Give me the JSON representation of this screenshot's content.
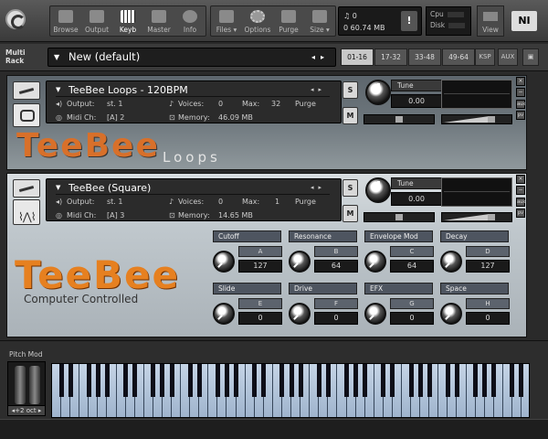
{
  "toolbar": {
    "buttons": [
      {
        "label": "Browse",
        "icon": "folder-icon"
      },
      {
        "label": "Output",
        "icon": "output-icon"
      },
      {
        "label": "Keyb",
        "icon": "keyboard-icon",
        "active": true
      },
      {
        "label": "Master",
        "icon": "metronome-icon"
      },
      {
        "label": "Info",
        "icon": "info-icon"
      }
    ],
    "buttons2": [
      {
        "label": "Files ▾",
        "icon": "disk-icon"
      },
      {
        "label": "Options",
        "icon": "gear-icon"
      },
      {
        "label": "Purge",
        "icon": "purge-icon"
      },
      {
        "label": "Size ▾",
        "icon": "size-icon"
      }
    ],
    "midi_count": "0",
    "memory": "60.74 MB",
    "cpu_label": "Cpu",
    "disk_label": "Disk",
    "view_label": "View",
    "ni_logo": "NI",
    "warn": "!"
  },
  "rack": {
    "label_line1": "Multi",
    "label_line2": "Rack",
    "name": "New (default)",
    "pages": [
      "01-16",
      "17-32",
      "33-48",
      "49-64"
    ],
    "ksp": "KSP",
    "aux": "AUX"
  },
  "instrument1": {
    "name": "TeeBee Loops - 120BPM",
    "output_label": "Output:",
    "output_value": "st. 1",
    "voices_label": "Voices:",
    "voices_value": "0",
    "max_label": "Max:",
    "max_value": "32",
    "purge_label": "Purge",
    "midi_label": "Midi Ch:",
    "midi_value": "[A]  2",
    "memory_label": "Memory:",
    "memory_value": "46.09 MB",
    "tune_label": "Tune",
    "tune_value": "0.00",
    "solo": "S",
    "mute": "M",
    "logo": "TeeBee",
    "subtitle": "Loops"
  },
  "instrument2": {
    "name": "TeeBee (Square)",
    "output_label": "Output:",
    "output_value": "st. 1",
    "voices_label": "Voices:",
    "voices_value": "0",
    "max_label": "Max:",
    "max_value": "1",
    "purge_label": "Purge",
    "midi_label": "Midi Ch:",
    "midi_value": "[A]  3",
    "memory_label": "Memory:",
    "memory_value": "14.65 MB",
    "tune_label": "Tune",
    "tune_value": "0.00",
    "solo": "S",
    "mute": "M",
    "logo": "TeeBee",
    "subtitle": "Computer Controlled",
    "controls": [
      {
        "label": "Cutoff",
        "key": "A",
        "value": "127"
      },
      {
        "label": "Resonance",
        "key": "B",
        "value": "64"
      },
      {
        "label": "Envelope Mod",
        "key": "C",
        "value": "64"
      },
      {
        "label": "Decay",
        "key": "D",
        "value": "127"
      },
      {
        "label": "Slide",
        "key": "E",
        "value": "0"
      },
      {
        "label": "Drive",
        "key": "F",
        "value": "0"
      },
      {
        "label": "EFX",
        "key": "G",
        "value": "0"
      },
      {
        "label": "Space",
        "key": "H",
        "value": "0"
      }
    ]
  },
  "side_buttons": [
    "x",
    "−",
    "aux",
    "pv"
  ],
  "keyboard": {
    "pitch_mod_label": "Pitch Mod",
    "octave": "◂+2 oct ▸"
  }
}
